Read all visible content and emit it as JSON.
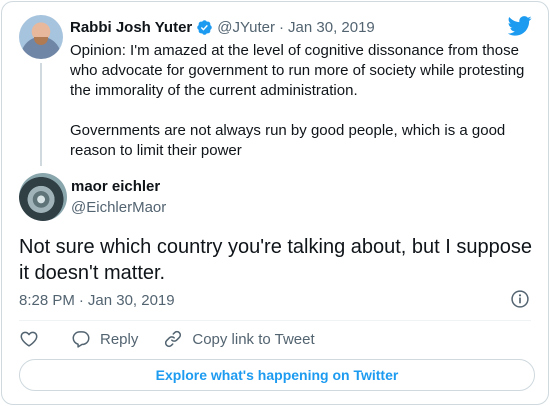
{
  "parent_tweet": {
    "author_name": "Rabbi Josh Yuter",
    "handle": "@JYuter",
    "separator": "·",
    "date": "Jan 30, 2019",
    "paragraphs": [
      "Opinion: I'm amazed at the level of cognitive dissonance from those who advocate for government to run more of society while protesting the immorality of the current administration.",
      "Governments are not always run by good people, which is a good reason to limit their power"
    ]
  },
  "main_tweet": {
    "author_name": "maor eichler",
    "handle": "@EichlerMaor",
    "text": "Not sure which country you're talking about, but I suppose it doesn't matter.",
    "time": "8:28 PM",
    "separator": "·",
    "date": "Jan 30, 2019"
  },
  "actions": {
    "reply_label": "Reply",
    "copy_label": "Copy link to Tweet"
  },
  "explore_label": "Explore what's happening on Twitter",
  "icons": {
    "brand": "twitter-bird-icon",
    "verified": "verified-badge-icon",
    "info": "info-icon",
    "like": "heart-icon",
    "reply": "speech-bubble-icon",
    "copy": "link-icon"
  },
  "colors": {
    "accent": "#1d9bf0",
    "text": "#0f1419",
    "secondary": "#536471",
    "border": "#cfd9de"
  }
}
